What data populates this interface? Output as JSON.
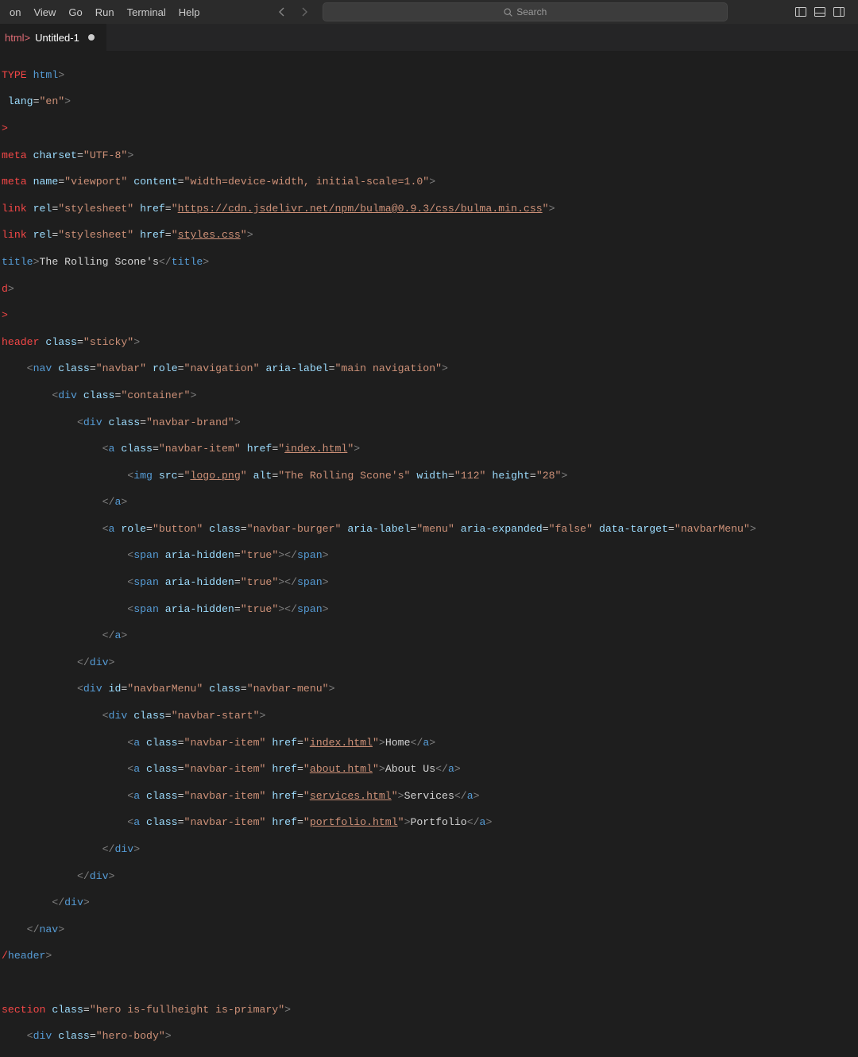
{
  "menu": {
    "items": [
      "on",
      "View",
      "Go",
      "Run",
      "Terminal",
      "Help"
    ]
  },
  "search": {
    "placeholder": "Search"
  },
  "tab": {
    "lang": "html>",
    "name": "Untitled-1"
  },
  "code": {
    "l1a": "TYPE ",
    "l1b": "html",
    "l1c": ">",
    "l2a": " ",
    "l2b": "lang",
    "l2c": "=",
    "l2d": "\"en\"",
    "l2e": ">",
    "l3a": ">",
    "l4a": "meta ",
    "l4b": "charset",
    "l4c": "=",
    "l4d": "\"UTF-8\"",
    "l4e": ">",
    "l5a": "meta ",
    "l5b": "name",
    "l5c": "=",
    "l5d": "\"viewport\"",
    "l5e": " ",
    "l5f": "content",
    "l5g": "=",
    "l5h": "\"width=device-width, initial-scale=1.0\"",
    "l5i": ">",
    "l6a": "link ",
    "l6b": "rel",
    "l6c": "=",
    "l6d": "\"stylesheet\"",
    "l6e": " ",
    "l6f": "href",
    "l6g": "=",
    "l6h": "\"",
    "l6i": "https://cdn.jsdelivr.net/npm/bulma@0.9.3/css/bulma.min.css",
    "l6j": "\"",
    "l6k": ">",
    "l7a": "link ",
    "l7b": "rel",
    "l7c": "=",
    "l7d": "\"stylesheet\"",
    "l7e": " ",
    "l7f": "href",
    "l7g": "=",
    "l7h": "\"",
    "l7i": "styles.css",
    "l7j": "\"",
    "l7k": ">",
    "l8a": "title",
    "l8b": ">",
    "l8c": "The Rolling Scone's",
    "l8d": "</",
    "l8e": "title",
    "l8f": ">",
    "l9a": "d",
    "l10a": ">",
    "l11a": "header ",
    "l11b": "class",
    "l11c": "=",
    "l11d": "\"sticky\"",
    "l11e": ">",
    "l12pad": "    ",
    "l12a": "<",
    "l12b": "nav ",
    "l12c": "class",
    "l12d": "=",
    "l12e": "\"navbar\"",
    "l12f": " ",
    "l12g": "role",
    "l12h": "=",
    "l12i": "\"navigation\"",
    "l12j": " ",
    "l12k": "aria-label",
    "l12l": "=",
    "l12m": "\"main navigation\"",
    "l12n": ">",
    "l13pad": "        ",
    "l13a": "<",
    "l13b": "div ",
    "l13c": "class",
    "l13d": "=",
    "l13e": "\"container\"",
    "l13f": ">",
    "l14pad": "            ",
    "l14a": "<",
    "l14b": "div ",
    "l14c": "class",
    "l14d": "=",
    "l14e": "\"navbar-brand\"",
    "l14f": ">",
    "l15pad": "                ",
    "l15a": "<",
    "l15b": "a ",
    "l15c": "class",
    "l15d": "=",
    "l15e": "\"navbar-item\"",
    "l15f": " ",
    "l15g": "href",
    "l15h": "=",
    "l15i": "\"",
    "l15j": "index.html",
    "l15k": "\"",
    "l15l": ">",
    "l16pad": "                    ",
    "l16a": "<",
    "l16b": "img ",
    "l16c": "src",
    "l16d": "=",
    "l16e": "\"",
    "l16f": "logo.png",
    "l16g": "\"",
    "l16h": " ",
    "l16i": "alt",
    "l16j": "=",
    "l16k": "\"The Rolling Scone's\"",
    "l16l": " ",
    "l16m": "width",
    "l16n": "=",
    "l16o": "\"112\"",
    "l16p": " ",
    "l16q": "height",
    "l16r": "=",
    "l16s": "\"28\"",
    "l16t": ">",
    "l17pad": "                ",
    "l17a": "</",
    "l17b": "a",
    "l17c": ">",
    "l18pad": "                ",
    "l18a": "<",
    "l18b": "a ",
    "l18c": "role",
    "l18d": "=",
    "l18e": "\"button\"",
    "l18f": " ",
    "l18g": "class",
    "l18h": "=",
    "l18i": "\"navbar-burger\"",
    "l18j": " ",
    "l18k": "aria-label",
    "l18l": "=",
    "l18m": "\"menu\"",
    "l18n": " ",
    "l18o": "aria-expanded",
    "l18p": "=",
    "l18q": "\"false\"",
    "l18r": " ",
    "l18s": "data-target",
    "l18t": "=",
    "l18u": "\"navbarMenu\"",
    "l18v": ">",
    "l19pad": "                    ",
    "l19a": "<",
    "l19b": "span ",
    "l19c": "aria-hidden",
    "l19d": "=",
    "l19e": "\"true\"",
    "l19f": "></",
    "l19g": "span",
    "l19h": ">",
    "l20pad": "                    ",
    "l20a": "<",
    "l20b": "span ",
    "l20c": "aria-hidden",
    "l20d": "=",
    "l20e": "\"true\"",
    "l20f": "></",
    "l20g": "span",
    "l20h": ">",
    "l21pad": "                    ",
    "l21a": "<",
    "l21b": "span ",
    "l21c": "aria-hidden",
    "l21d": "=",
    "l21e": "\"true\"",
    "l21f": "></",
    "l21g": "span",
    "l21h": ">",
    "l22pad": "                ",
    "l22a": "</",
    "l22b": "a",
    "l22c": ">",
    "l23pad": "            ",
    "l23a": "</",
    "l23b": "div",
    "l23c": ">",
    "l24pad": "            ",
    "l24a": "<",
    "l24b": "div ",
    "l24c": "id",
    "l24d": "=",
    "l24e": "\"navbarMenu\"",
    "l24f": " ",
    "l24g": "class",
    "l24h": "=",
    "l24i": "\"navbar-menu\"",
    "l24j": ">",
    "l25pad": "                ",
    "l25a": "<",
    "l25b": "div ",
    "l25c": "class",
    "l25d": "=",
    "l25e": "\"navbar-start\"",
    "l25f": ">",
    "l26pad": "                    ",
    "l26a": "<",
    "l26b": "a ",
    "l26c": "class",
    "l26d": "=",
    "l26e": "\"navbar-item\"",
    "l26f": " ",
    "l26g": "href",
    "l26h": "=",
    "l26i": "\"",
    "l26j": "index.html",
    "l26k": "\"",
    "l26l": ">",
    "l26m": "Home",
    "l26n": "</",
    "l26o": "a",
    "l26p": ">",
    "l27pad": "                    ",
    "l27a": "<",
    "l27b": "a ",
    "l27c": "class",
    "l27d": "=",
    "l27e": "\"navbar-item\"",
    "l27f": " ",
    "l27g": "href",
    "l27h": "=",
    "l27i": "\"",
    "l27j": "about.html",
    "l27k": "\"",
    "l27l": ">",
    "l27m": "About Us",
    "l27n": "</",
    "l27o": "a",
    "l27p": ">",
    "l28pad": "                    ",
    "l28a": "<",
    "l28b": "a ",
    "l28c": "class",
    "l28d": "=",
    "l28e": "\"navbar-item\"",
    "l28f": " ",
    "l28g": "href",
    "l28h": "=",
    "l28i": "\"",
    "l28j": "services.html",
    "l28k": "\"",
    "l28l": ">",
    "l28m": "Services",
    "l28n": "</",
    "l28o": "a",
    "l28p": ">",
    "l29pad": "                    ",
    "l29a": "<",
    "l29b": "a ",
    "l29c": "class",
    "l29d": "=",
    "l29e": "\"navbar-item\"",
    "l29f": " ",
    "l29g": "href",
    "l29h": "=",
    "l29i": "\"",
    "l29j": "portfolio.html",
    "l29k": "\"",
    "l29l": ">",
    "l29m": "Portfolio",
    "l29n": "</",
    "l29o": "a",
    "l29p": ">",
    "l30pad": "                ",
    "l30a": "</",
    "l30b": "div",
    "l30c": ">",
    "l31pad": "            ",
    "l31a": "</",
    "l31b": "div",
    "l31c": ">",
    "l32pad": "        ",
    "l32a": "</",
    "l32b": "div",
    "l32c": ">",
    "l33pad": "    ",
    "l33a": "</",
    "l33b": "nav",
    "l33c": ">",
    "l34a": "/",
    "l34b": "header",
    "l34c": ">",
    "l35a": "section ",
    "l35b": "class",
    "l35c": "=",
    "l35d": "\"hero is-fullheight is-primary\"",
    "l35e": ">",
    "l36pad": "    ",
    "l36a": "<",
    "l36b": "div ",
    "l36c": "class",
    "l36d": "=",
    "l36e": "\"hero-body\"",
    "l36f": ">"
  }
}
